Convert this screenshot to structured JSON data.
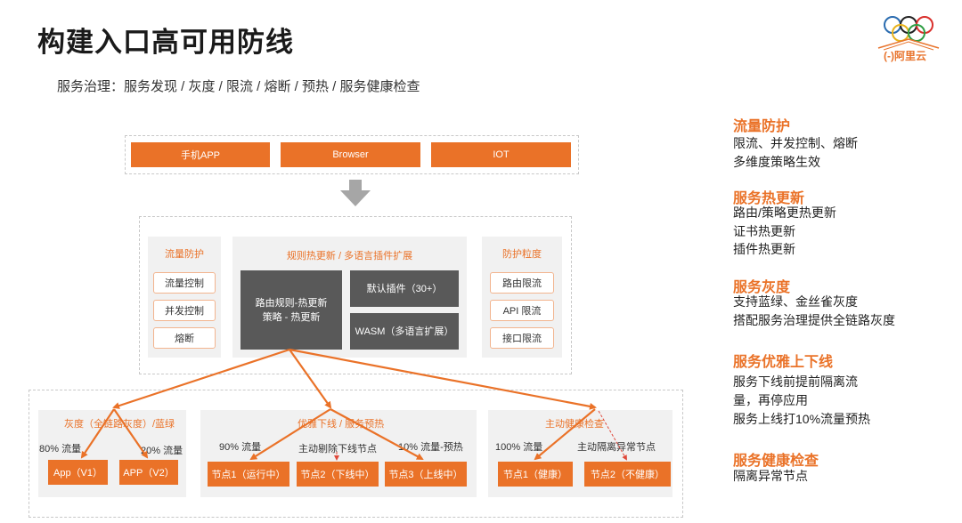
{
  "title": "构建入口高可用防线",
  "subtitle": "服务治理：服务发现 / 灰度 / 限流 / 熔断 / 预热 / 服务健康检查",
  "logo": {
    "text": "(-)阿里云"
  },
  "clients": [
    "手机APP",
    "Browser",
    "IOT"
  ],
  "gateway": {
    "left": {
      "title": "流量防护",
      "items": [
        "流量控制",
        "并发控制",
        "熔断"
      ]
    },
    "middle": {
      "title": "规则热更新 / 多语言插件扩展",
      "dark_main": "路由规则-热更新\n策略 - 热更新",
      "dark_plugins": "默认插件（30+）",
      "dark_wasm": "WASM（多语言扩展）"
    },
    "right": {
      "title": "防护粒度",
      "items": [
        "路由限流",
        "API 限流",
        "接口限流"
      ]
    }
  },
  "bottom": {
    "gray": {
      "title": "灰度（全链路灰度）/蓝绿",
      "label_left": "80% 流量",
      "label_right": "20% 流量",
      "nodes": [
        "App（V1）",
        "APP（V2）"
      ]
    },
    "offline": {
      "title": "优雅下线 / 服务预热",
      "label_left": "90% 流量",
      "label_mid": "主动剔除下线节点",
      "label_right": "10% 流量-预热",
      "nodes": [
        "节点1（运行中）",
        "节点2（下线中）",
        "节点3（上线中）"
      ]
    },
    "health": {
      "title": "主动健康检查",
      "label_left": "100% 流量",
      "label_right": "主动隔离异常节点",
      "nodes": [
        "节点1（健康）",
        "节点2（不健康）"
      ]
    }
  },
  "right_panel": [
    {
      "heading": "流量防护",
      "lines": [
        "限流、并发控制、熔断",
        "多维度策略生效"
      ]
    },
    {
      "heading": "服务热更新",
      "lines": [
        "路由/策略更热更新",
        "证书热更新",
        "插件热更新"
      ]
    },
    {
      "heading": "服务灰度",
      "lines": [
        "支持蓝绿、金丝雀灰度",
        "搭配服务治理提供全链路灰度"
      ]
    },
    {
      "heading": "服务优雅上下线",
      "lines": [
        "服务下线前提前隔离流",
        "量，再停应用",
        "服务上线打10%流量预热"
      ]
    },
    {
      "heading": "服务健康检查",
      "lines": [
        "隔离异常节点"
      ]
    }
  ],
  "colors": {
    "accent": "#ea7228",
    "dark_box": "#595959",
    "panel": "#f1f1f1"
  }
}
